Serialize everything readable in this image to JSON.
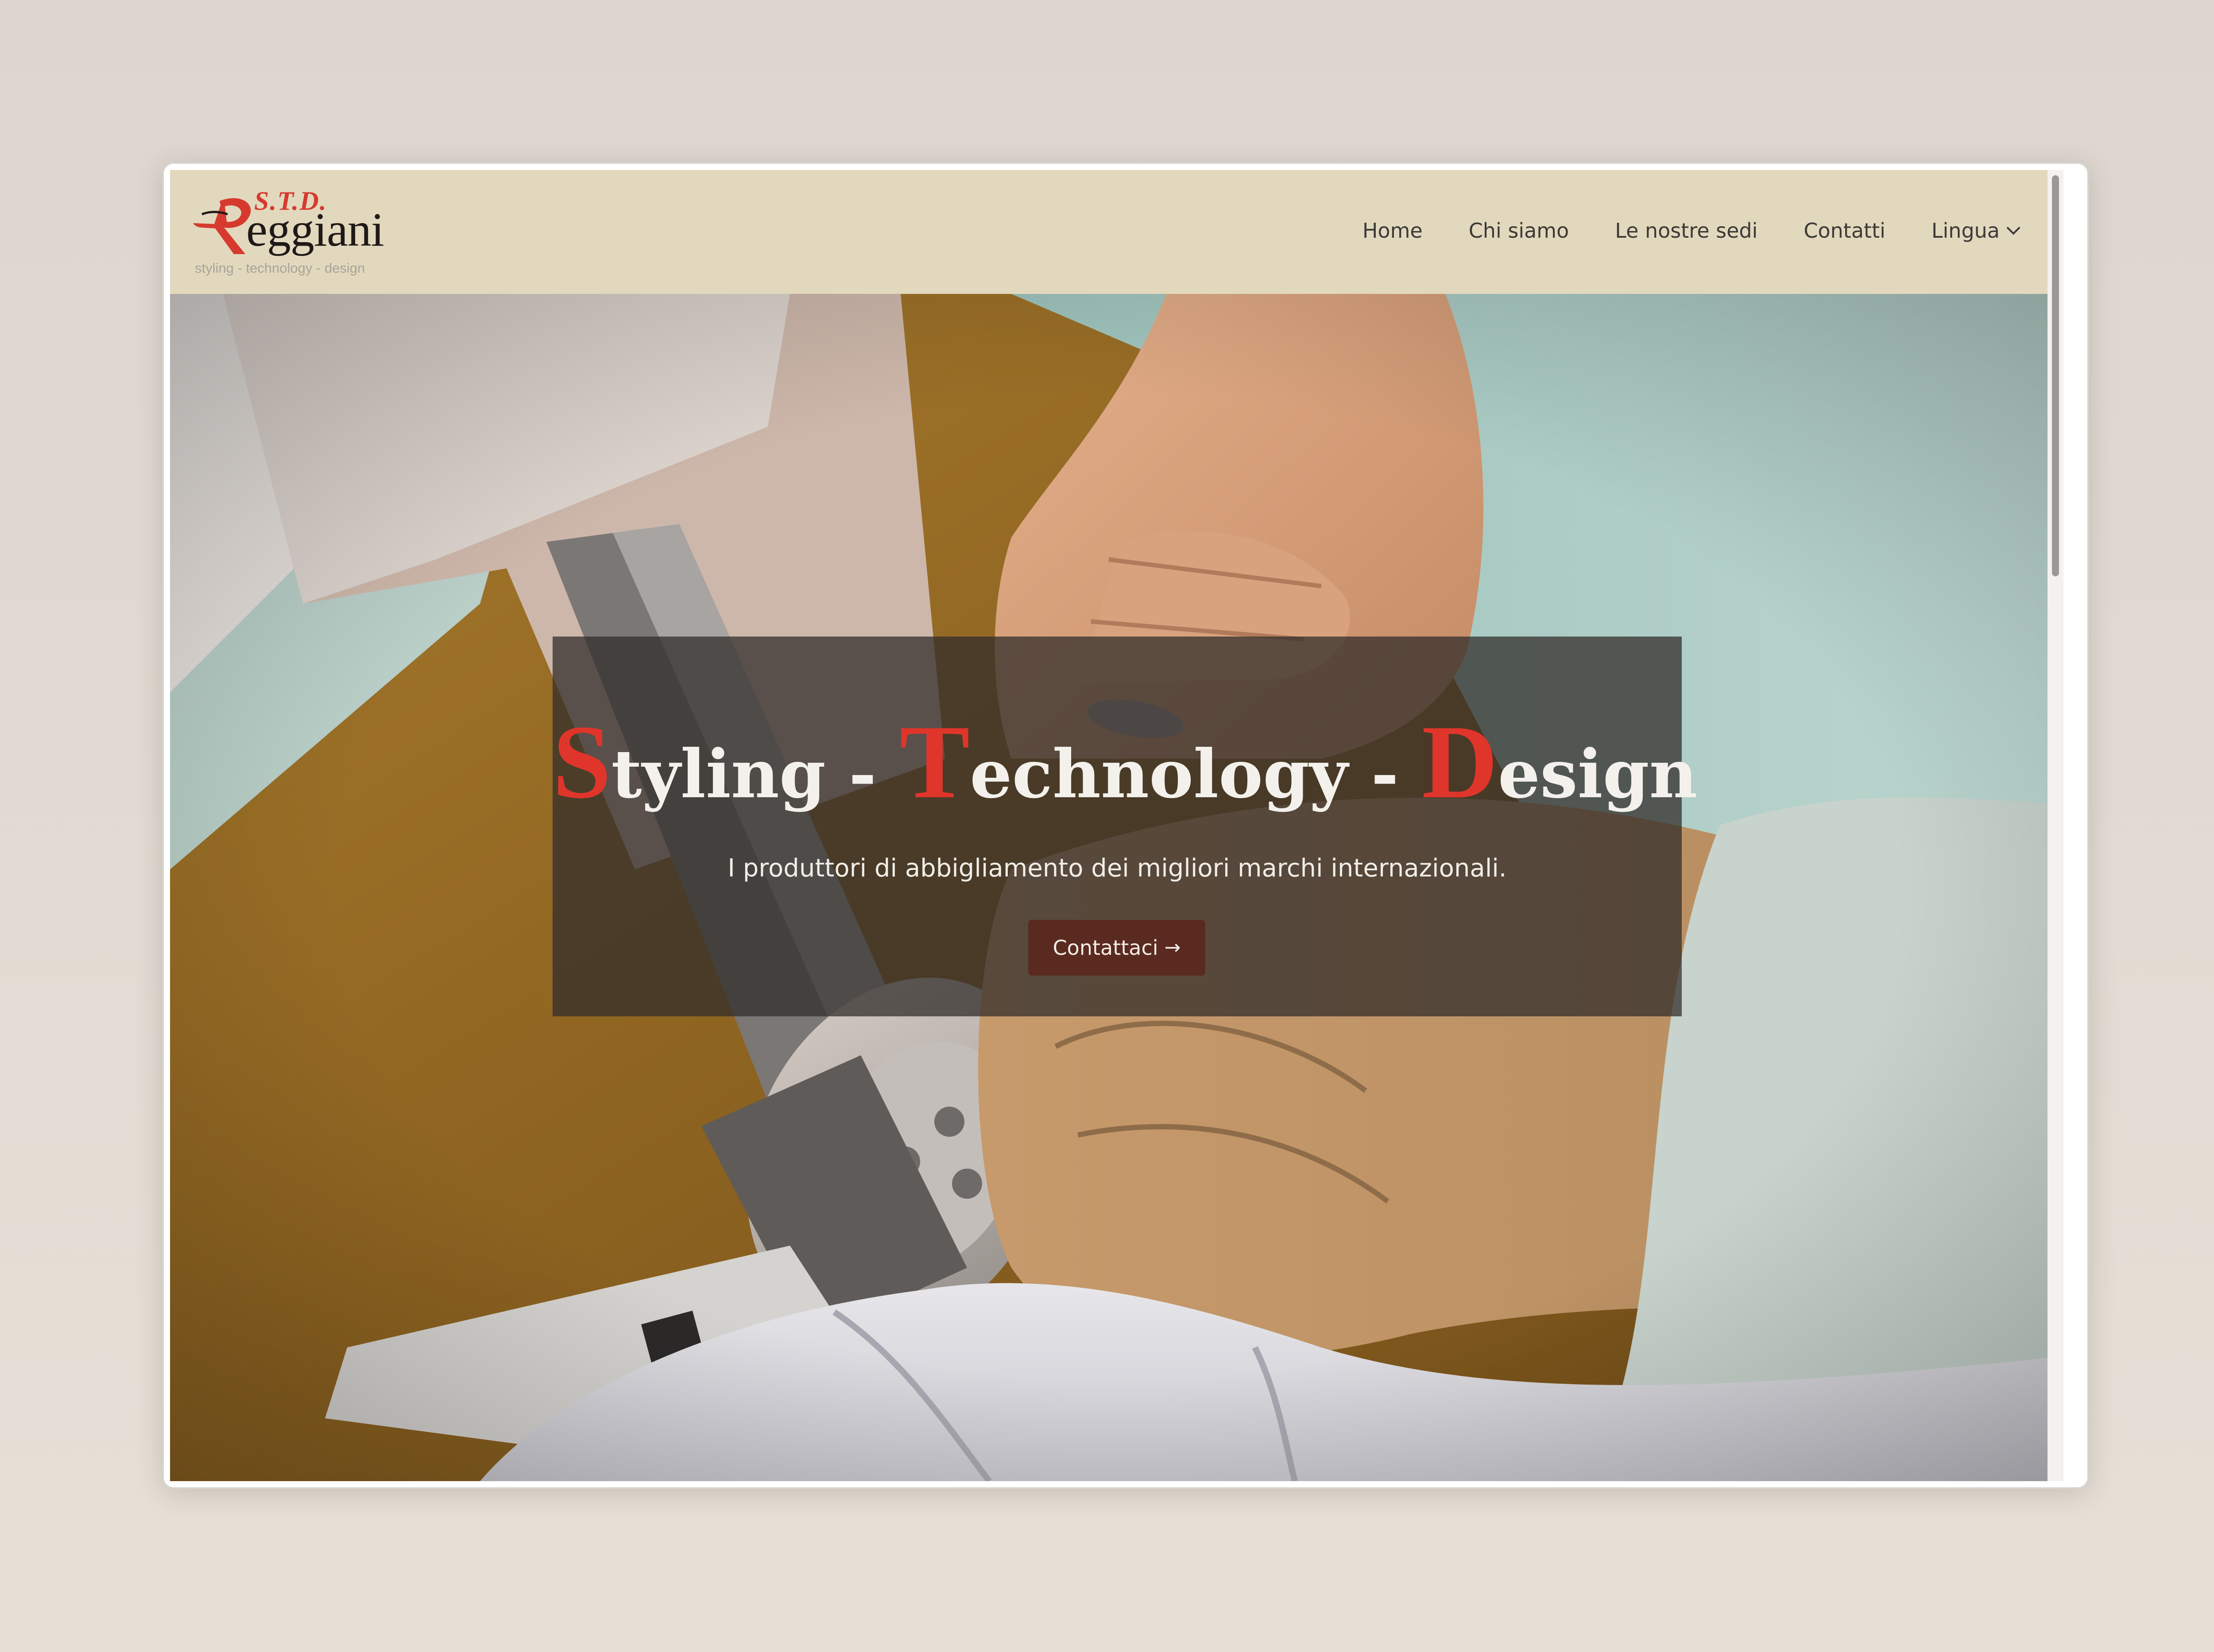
{
  "logo": {
    "prefix": "S.T.D.",
    "name": "eggiani",
    "tagline": "styling - technology - design"
  },
  "nav": {
    "items": [
      {
        "label": "Home"
      },
      {
        "label": "Chi siamo"
      },
      {
        "label": "Le nostre sedi"
      },
      {
        "label": "Contatti"
      }
    ],
    "language": {
      "label": "Lingua",
      "icon": "chevron-down-icon"
    }
  },
  "hero": {
    "title_parts": [
      {
        "cap": "S",
        "rest": "tyling - "
      },
      {
        "cap": "T",
        "rest": "echnology - "
      },
      {
        "cap": "D",
        "rest": "esign"
      }
    ],
    "subtitle": "I produttori di abbigliamento dei migliori marchi internazionali.",
    "cta": {
      "label": "Contattaci",
      "icon": "arrow-right-icon",
      "glyph": "→"
    }
  },
  "colors": {
    "header_bg": "#e2d8bd",
    "accent_red": "#e0352b",
    "cta_bg": "#5a2a20",
    "card_overlay": "rgba(48,44,42,0.74)"
  }
}
